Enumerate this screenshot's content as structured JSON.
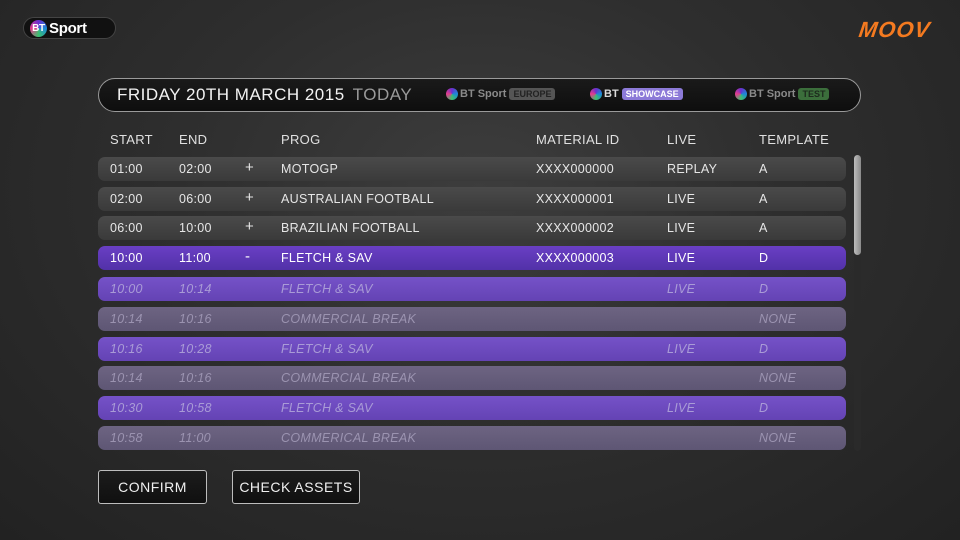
{
  "brand": {
    "bt_badge": "BT",
    "bt_text": "Sport",
    "moov": "MOOV"
  },
  "datebar": {
    "date": "FRIDAY 20TH MARCH 2015",
    "today": "TODAY",
    "channels": [
      {
        "badge_text": "BT Sport",
        "pill": "EUROPE"
      },
      {
        "badge_text": "BT",
        "pill": "SHOWCASE"
      },
      {
        "badge_text": "BT Sport",
        "pill": "TEST"
      }
    ]
  },
  "columns": {
    "start": "START",
    "end": "END",
    "prog": "PROG",
    "material_id": "MATERIAL ID",
    "live": "LIVE",
    "template": "TEMPLATE"
  },
  "rows": [
    {
      "start": "01:00",
      "end": "02:00",
      "sign": "+",
      "prog": "MOTOGP",
      "material_id": "XXXX000000",
      "live": "REPLAY",
      "template": "A"
    },
    {
      "start": "02:00",
      "end": "06:00",
      "sign": "+",
      "prog": "AUSTRALIAN FOOTBALL",
      "material_id": "XXXX000001",
      "live": "LIVE",
      "template": "A"
    },
    {
      "start": "06:00",
      "end": "10:00",
      "sign": "+",
      "prog": "BRAZILIAN FOOTBALL",
      "material_id": "XXXX000002",
      "live": "LIVE",
      "template": "A"
    },
    {
      "start": "10:00",
      "end": "11:00",
      "sign": "-",
      "prog": "FLETCH & SAV",
      "material_id": "XXXX000003",
      "live": "LIVE",
      "template": "D"
    },
    {
      "start": "10:00",
      "end": "10:14",
      "sign": "",
      "prog": "FLETCH & SAV",
      "material_id": "",
      "live": "LIVE",
      "template": "D"
    },
    {
      "start": "10:14",
      "end": "10:16",
      "sign": "",
      "prog": "COMMERCIAL BREAK",
      "material_id": "",
      "live": "",
      "template": "NONE"
    },
    {
      "start": "10:16",
      "end": "10:28",
      "sign": "",
      "prog": "FLETCH & SAV",
      "material_id": "",
      "live": "LIVE",
      "template": "D"
    },
    {
      "start": "10:14",
      "end": "10:16",
      "sign": "",
      "prog": "COMMERCIAL BREAK",
      "material_id": "",
      "live": "",
      "template": "NONE"
    },
    {
      "start": "10:30",
      "end": "10:58",
      "sign": "",
      "prog": "FLETCH & SAV",
      "material_id": "",
      "live": "LIVE",
      "template": "D"
    },
    {
      "start": "10:58",
      "end": "11:00",
      "sign": "",
      "prog": "COMMERICAL BREAK",
      "material_id": "",
      "live": "",
      "template": "NONE"
    }
  ],
  "buttons": {
    "confirm": "CONFIRM",
    "check_assets": "CHECK ASSETS"
  }
}
